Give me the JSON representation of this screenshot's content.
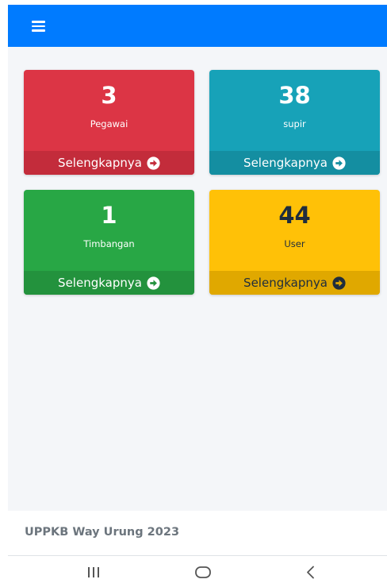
{
  "cards": [
    {
      "count": "3",
      "label": "Pegawai",
      "more": "Selengkapnya",
      "color": "#dc3545",
      "footer_color": "#c32c3b"
    },
    {
      "count": "38",
      "label": "supir",
      "more": "Selengkapnya",
      "color": "#17a2b8",
      "footer_color": "#148ea1"
    },
    {
      "count": "1",
      "label": "Timbangan",
      "more": "Selengkapnya",
      "color": "#28a745",
      "footer_color": "#23923d"
    },
    {
      "count": "44",
      "label": "User",
      "more": "Selengkapnya",
      "color": "#ffc107",
      "footer_color": "#e0a800"
    }
  ],
  "footer": {
    "brand": "UPPKB Way Urung 2023"
  },
  "theme": {
    "primary": "#007bff",
    "content_bg": "#f4f6f9",
    "brand_text": "#6c757d"
  },
  "icons": {
    "menu": "hamburger-menu-icon",
    "more": "arrow-circle-right-icon",
    "nav_recent": "recent-apps-icon",
    "nav_home": "home-circle-icon",
    "nav_back": "back-chevron-icon"
  }
}
